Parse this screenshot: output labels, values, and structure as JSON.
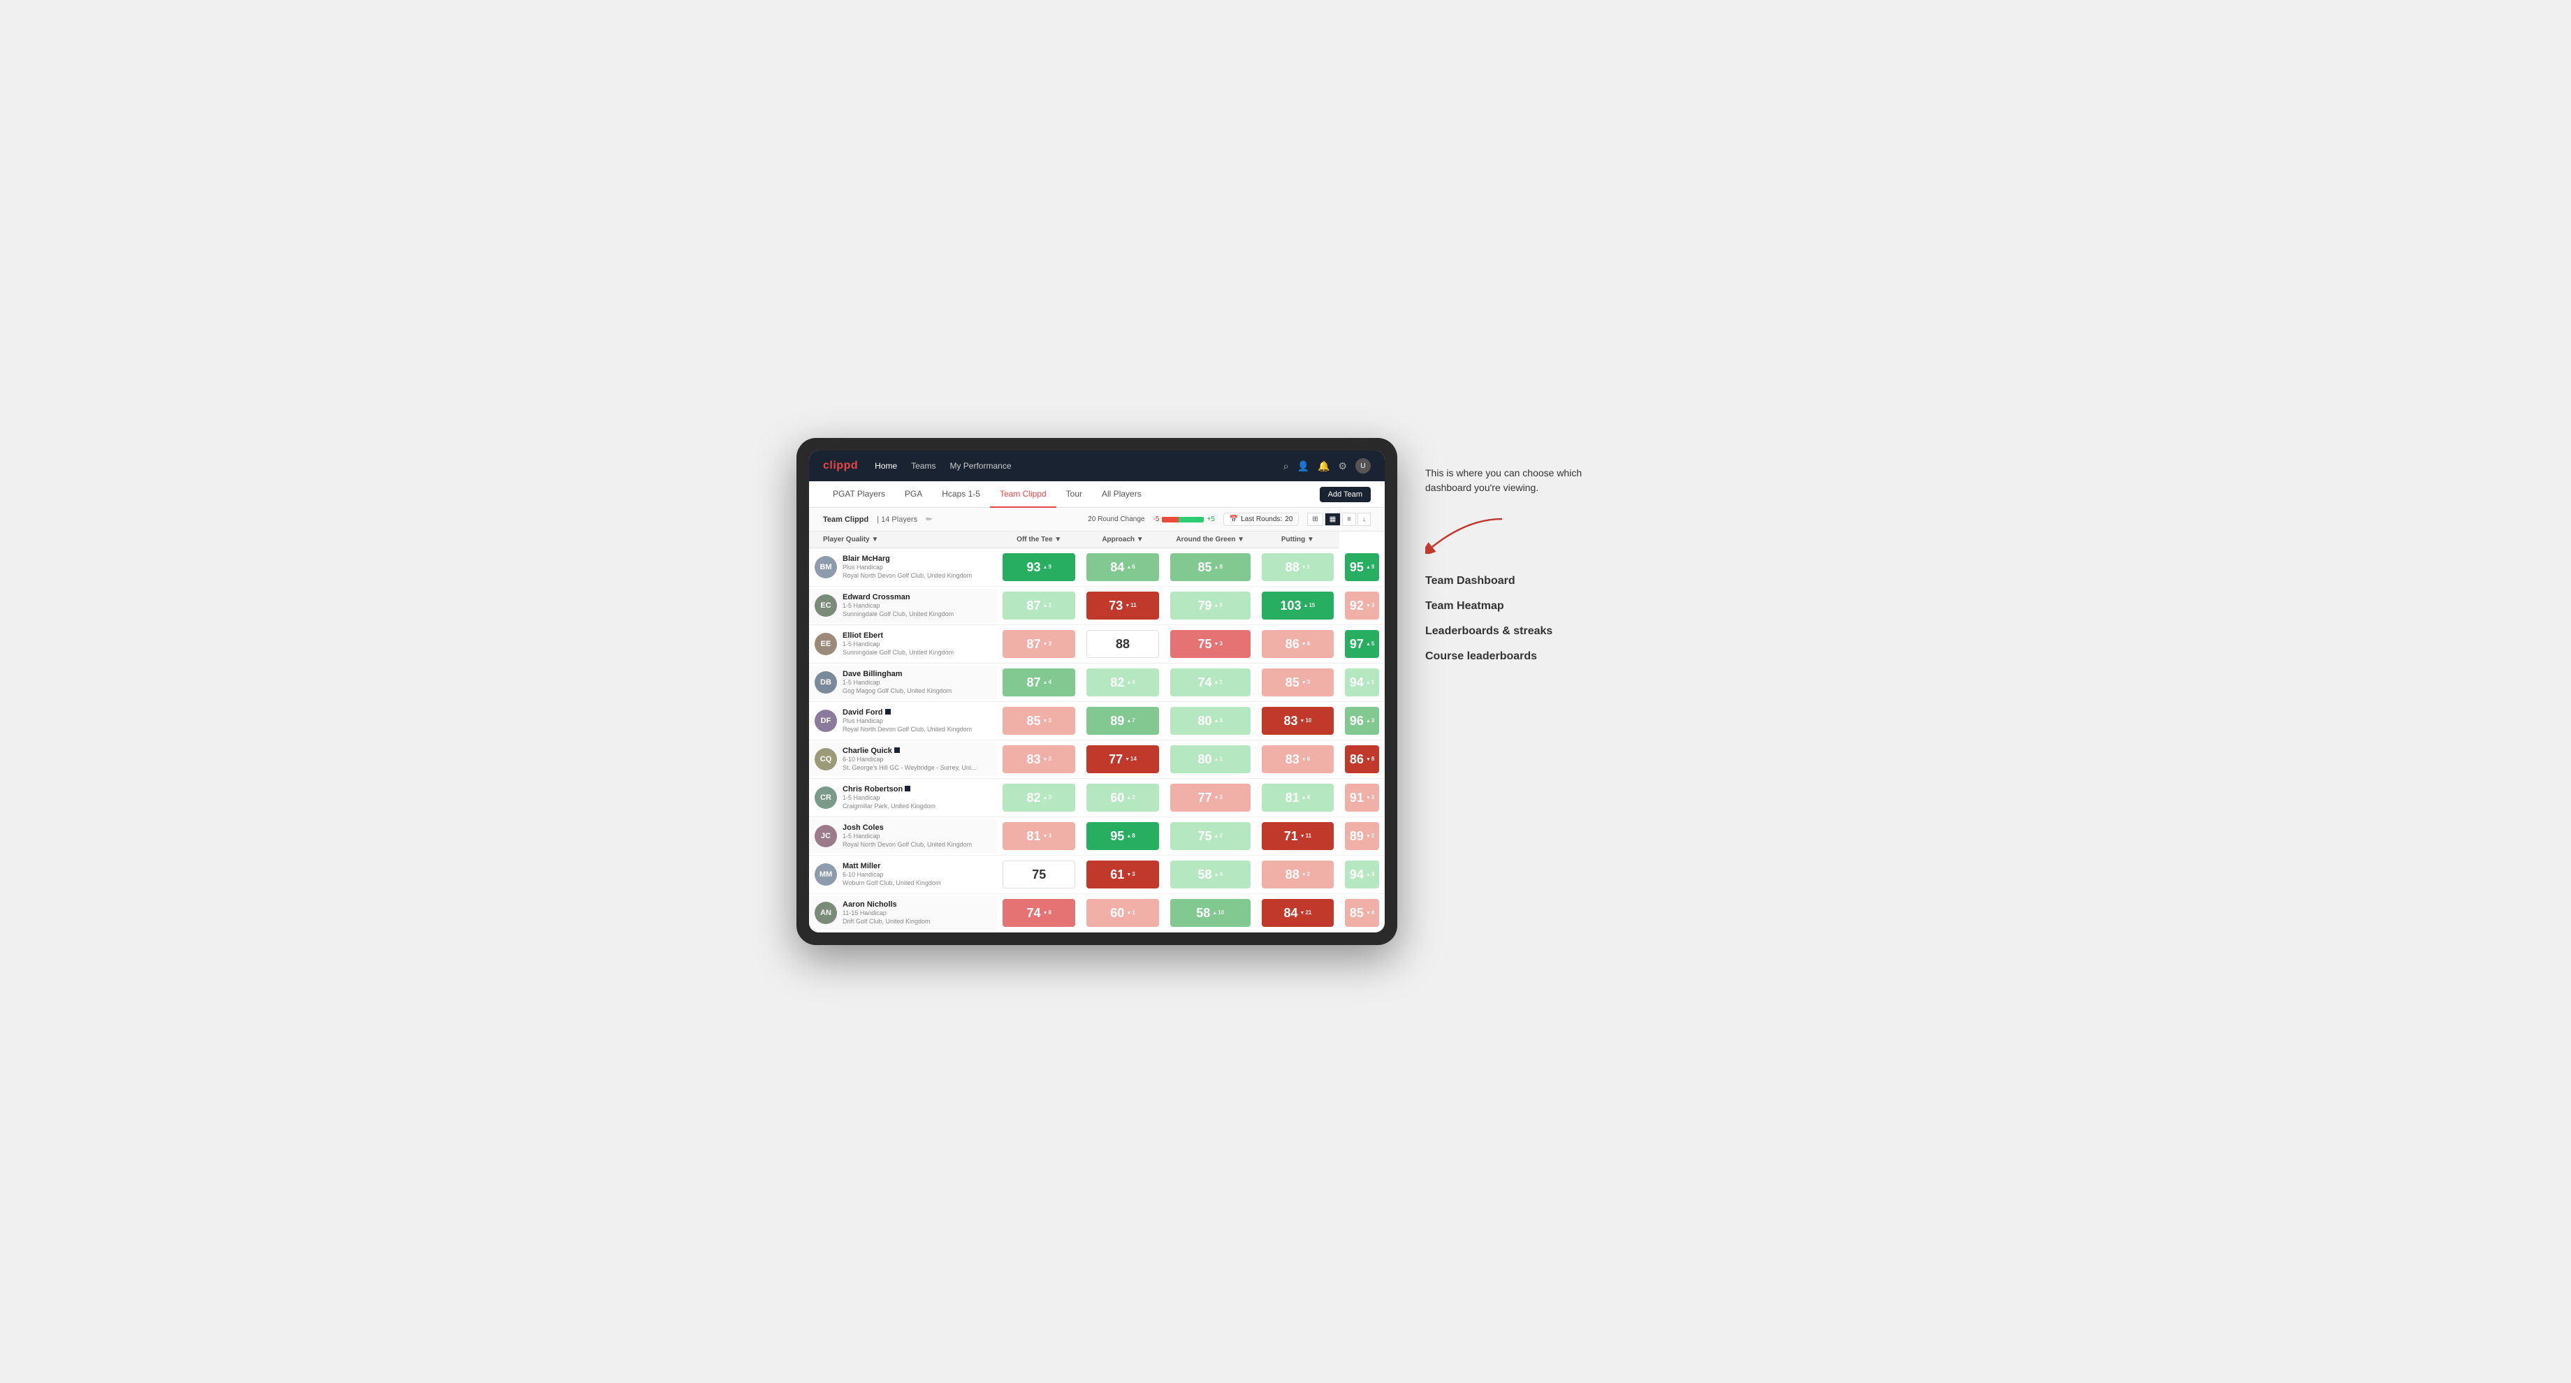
{
  "annotation": {
    "description": "This is where you can choose which dashboard you're viewing.",
    "items": [
      "Team Dashboard",
      "Team Heatmap",
      "Leaderboards & streaks",
      "Course leaderboards"
    ]
  },
  "navbar": {
    "logo": "clippd",
    "links": [
      "Home",
      "Teams",
      "My Performance"
    ]
  },
  "subnav": {
    "links": [
      "PGAT Players",
      "PGA",
      "Hcaps 1-5",
      "Team Clippd",
      "Tour",
      "All Players"
    ],
    "active": "Team Clippd",
    "add_team_label": "Add Team"
  },
  "team_bar": {
    "name": "Team Clippd",
    "separator": "|",
    "count": "14 Players",
    "round_change_label": "20 Round Change",
    "neg": "-5",
    "pos": "+5",
    "last_rounds_label": "Last Rounds:",
    "last_rounds_value": "20"
  },
  "table": {
    "columns": [
      "Player Quality ▼",
      "Off the Tee ▼",
      "Approach ▼",
      "Around the Green ▼",
      "Putting ▼"
    ],
    "rows": [
      {
        "name": "Blair McHarg",
        "handicap": "Plus Handicap",
        "club": "Royal North Devon Golf Club, United Kingdom",
        "scores": [
          {
            "value": "93",
            "change": "9",
            "dir": "up",
            "color": "green-dark"
          },
          {
            "value": "84",
            "change": "6",
            "dir": "up",
            "color": "green-light"
          },
          {
            "value": "85",
            "change": "8",
            "dir": "up",
            "color": "green-light"
          },
          {
            "value": "88",
            "change": "1",
            "dir": "down",
            "color": "green-pale"
          },
          {
            "value": "95",
            "change": "9",
            "dir": "up",
            "color": "green-dark"
          }
        ]
      },
      {
        "name": "Edward Crossman",
        "handicap": "1-5 Handicap",
        "club": "Sunningdale Golf Club, United Kingdom",
        "scores": [
          {
            "value": "87",
            "change": "1",
            "dir": "up",
            "color": "green-pale"
          },
          {
            "value": "73",
            "change": "11",
            "dir": "down",
            "color": "red-dark"
          },
          {
            "value": "79",
            "change": "9",
            "dir": "up",
            "color": "green-pale"
          },
          {
            "value": "103",
            "change": "15",
            "dir": "up",
            "color": "green-dark"
          },
          {
            "value": "92",
            "change": "3",
            "dir": "down",
            "color": "red-pale"
          }
        ]
      },
      {
        "name": "Elliot Ebert",
        "handicap": "1-5 Handicap",
        "club": "Sunningdale Golf Club, United Kingdom",
        "scores": [
          {
            "value": "87",
            "change": "3",
            "dir": "down",
            "color": "red-pale"
          },
          {
            "value": "88",
            "change": "",
            "dir": "",
            "color": "white"
          },
          {
            "value": "75",
            "change": "3",
            "dir": "down",
            "color": "red-light"
          },
          {
            "value": "86",
            "change": "6",
            "dir": "down",
            "color": "red-pale"
          },
          {
            "value": "97",
            "change": "5",
            "dir": "up",
            "color": "green-dark"
          }
        ]
      },
      {
        "name": "Dave Billingham",
        "handicap": "1-5 Handicap",
        "club": "Gog Magog Golf Club, United Kingdom",
        "scores": [
          {
            "value": "87",
            "change": "4",
            "dir": "up",
            "color": "green-light"
          },
          {
            "value": "82",
            "change": "4",
            "dir": "up",
            "color": "green-pale"
          },
          {
            "value": "74",
            "change": "1",
            "dir": "up",
            "color": "green-pale"
          },
          {
            "value": "85",
            "change": "3",
            "dir": "down",
            "color": "red-pale"
          },
          {
            "value": "94",
            "change": "1",
            "dir": "up",
            "color": "green-pale"
          }
        ]
      },
      {
        "name": "David Ford",
        "handicap": "Plus Handicap",
        "club": "Royal North Devon Golf Club, United Kingdom",
        "scores": [
          {
            "value": "85",
            "change": "3",
            "dir": "down",
            "color": "red-pale"
          },
          {
            "value": "89",
            "change": "7",
            "dir": "up",
            "color": "green-light"
          },
          {
            "value": "80",
            "change": "3",
            "dir": "up",
            "color": "green-pale"
          },
          {
            "value": "83",
            "change": "10",
            "dir": "down",
            "color": "red-dark"
          },
          {
            "value": "96",
            "change": "3",
            "dir": "up",
            "color": "green-light"
          }
        ]
      },
      {
        "name": "Charlie Quick",
        "handicap": "6-10 Handicap",
        "club": "St. George's Hill GC - Weybridge - Surrey, Uni...",
        "scores": [
          {
            "value": "83",
            "change": "3",
            "dir": "down",
            "color": "red-pale"
          },
          {
            "value": "77",
            "change": "14",
            "dir": "down",
            "color": "red-dark"
          },
          {
            "value": "80",
            "change": "1",
            "dir": "up",
            "color": "green-pale"
          },
          {
            "value": "83",
            "change": "6",
            "dir": "down",
            "color": "red-pale"
          },
          {
            "value": "86",
            "change": "8",
            "dir": "down",
            "color": "red-dark"
          }
        ]
      },
      {
        "name": "Chris Robertson",
        "handicap": "1-5 Handicap",
        "club": "Craigmillar Park, United Kingdom",
        "scores": [
          {
            "value": "82",
            "change": "3",
            "dir": "up",
            "color": "green-pale"
          },
          {
            "value": "60",
            "change": "2",
            "dir": "up",
            "color": "green-pale"
          },
          {
            "value": "77",
            "change": "3",
            "dir": "down",
            "color": "red-pale"
          },
          {
            "value": "81",
            "change": "4",
            "dir": "up",
            "color": "green-pale"
          },
          {
            "value": "91",
            "change": "3",
            "dir": "down",
            "color": "red-pale"
          }
        ]
      },
      {
        "name": "Josh Coles",
        "handicap": "1-5 Handicap",
        "club": "Royal North Devon Golf Club, United Kingdom",
        "scores": [
          {
            "value": "81",
            "change": "3",
            "dir": "down",
            "color": "red-pale"
          },
          {
            "value": "95",
            "change": "8",
            "dir": "up",
            "color": "green-dark"
          },
          {
            "value": "75",
            "change": "2",
            "dir": "up",
            "color": "green-pale"
          },
          {
            "value": "71",
            "change": "11",
            "dir": "down",
            "color": "red-dark"
          },
          {
            "value": "89",
            "change": "2",
            "dir": "down",
            "color": "red-pale"
          }
        ]
      },
      {
        "name": "Matt Miller",
        "handicap": "6-10 Handicap",
        "club": "Woburn Golf Club, United Kingdom",
        "scores": [
          {
            "value": "75",
            "change": "",
            "dir": "",
            "color": "white"
          },
          {
            "value": "61",
            "change": "3",
            "dir": "down",
            "color": "red-dark"
          },
          {
            "value": "58",
            "change": "4",
            "dir": "up",
            "color": "green-pale"
          },
          {
            "value": "88",
            "change": "2",
            "dir": "down",
            "color": "red-pale"
          },
          {
            "value": "94",
            "change": "3",
            "dir": "up",
            "color": "green-pale"
          }
        ]
      },
      {
        "name": "Aaron Nicholls",
        "handicap": "11-15 Handicap",
        "club": "Drift Golf Club, United Kingdom",
        "scores": [
          {
            "value": "74",
            "change": "8",
            "dir": "down",
            "color": "red-light"
          },
          {
            "value": "60",
            "change": "1",
            "dir": "down",
            "color": "red-pale"
          },
          {
            "value": "58",
            "change": "10",
            "dir": "up",
            "color": "green-light"
          },
          {
            "value": "84",
            "change": "21",
            "dir": "down",
            "color": "red-dark"
          },
          {
            "value": "85",
            "change": "4",
            "dir": "down",
            "color": "red-pale"
          }
        ]
      }
    ]
  },
  "icons": {
    "search": "🔍",
    "user": "👤",
    "bell": "🔔",
    "settings": "⚙",
    "avatar": "👤",
    "edit": "✏",
    "grid": "⊞",
    "list": "≡",
    "download": "↓",
    "calendar": "📅"
  }
}
